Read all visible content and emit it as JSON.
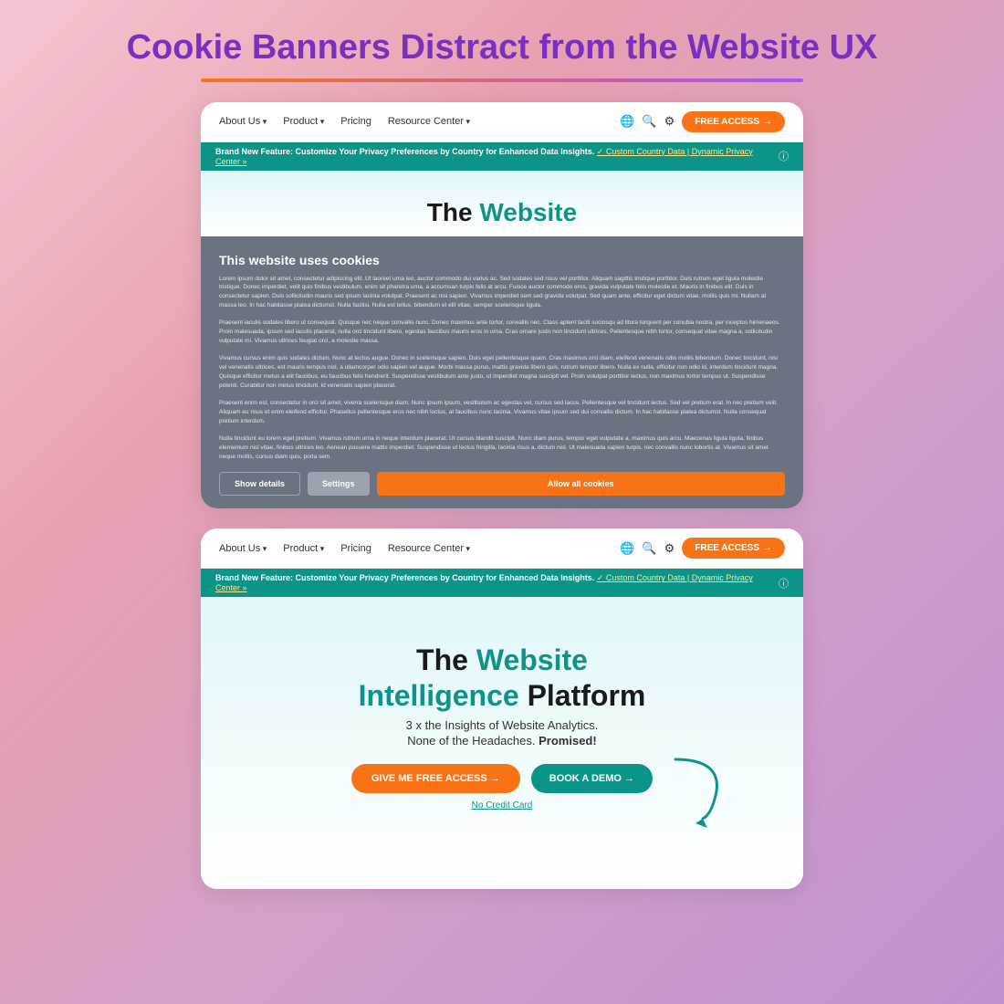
{
  "page": {
    "title_line1": "Cookie Banners Distract from the Website UX"
  },
  "navbar": {
    "about": "About Us",
    "product": "Product",
    "pricing": "Pricing",
    "resource": "Resource Center",
    "free_access": "FREE ACCESS",
    "arrow": "→"
  },
  "teal_banner": {
    "text": "Brand New Feature: Customize Your Privacy Preferences by Country for Enhanced Data Insights.",
    "link_text": "✓ Custom Country Data | Dynamic Privacy Center »",
    "close": "ⓘ"
  },
  "hero_top": {
    "title_plain": "The",
    "title_accent": "Website"
  },
  "cookie": {
    "title": "This website uses cookies",
    "body1": "Lorem ipsum dolor sit amet, consectetur adipiscing elit. Ut laoreet urna leo, auctor commodo dui varius ac. Sed sodales sed risus vel porttitor. Aliquam sagittis tristique porttitor. Duis rutrum eget ligula molestie tristique. Donec imperdiet, velit quis finibus vestibulum, enim sit pharetra urna, a accumsan turpis felis at arcu. Fuisce auctor commodo eros, gravida vulputate felis molestie et. Mauris in finibus elit. Duis in consectetur sapien. Duis sollicitudin mauris sed ipsum lacinia volutpat. Praesent ac nisi sapien. Vivamus imperdiet sem sed gravida volutpat. Sed quam ante, efficitur eget dictum vitae, mollis quis mi. Nullam at massa leo. In hac habitasse platea dictumst. Nulla facilisi. Nulla est tellus, bibendum et elit vitae, semper scelerisque ligula.",
    "body2": "Praesent iaculis sodales libero ut consequat. Quisque nec neque convallis nunc. Donec maximus ante tortor, convallis nec. Class aptent taciti sociosqu ad litora torquent per conubia nostra, per inceptos himenaeos. Proin malesuada, ipsum sed iaculis placerat, nulla orci tincidunt libero, egestas faucibus mauris eros in urna. Cras ornare justo non tincidunt ultrices. Pellentesque nibh tortor, consequat vitae magna a, sollicitudin vulputate mi. Vivamus ultrices feugiat orci, a molestie massa.",
    "body3": "Vivamus cursus enim quis sodales dictum. Nunc at lectus augue. Donec in scelerisque sapien. Duis eget pellentesque quam. Cras maximus orci diam, eleifend venenatis odio mollis bibendum. Donec tincidunt, nisi vel venenatis ultrices, est mauris tempus nisl, a ullamcorper odio sapien vel augue. Morbi massa purus, mattis gravida libero quis, rutrum tempor libero. Nulla ex nulla, efficitur non odio id, interdum tincidunt magna. Quisque efficitur metus a elit faucibus, eu faucibus felis hendrerit. Suspendisse vestibulum ante justo, ut imperdiet magna suscipit vel. Proin volutpat porttitor lectus, non maximus tortor tempus ut. Suspendisse potenti. Curabitur non metus tincidunt, id venenatis sapien placerat.",
    "body4": "Praesent enim est, consectetur in orci sit amet, viverra scelerisque diam. Nunc ipsum ipsum, vestibulum ac egestas vel, cursus sed lacus. Pellentesque vel tincidunt lectus. Sed vel pretium erat. In nec pretium velit. Aliquam eu risus et enim eleifend efficitur. Phasellus pellentesque eros nec nibh luctus, at faucibus nunc lacinia. Vivamus vitae ipsum sed dui convallis dictum. In hac habitasse platea dictumst. Nulla consequat pretium interdum.",
    "body5": "Nulla tincidunt eu lorem eget pretium. Vivamus rutrum urna in neque interdum placerat. Ut cursus blandit suscipit. Nunc diam purus, tempor eget vulputate a, maximus quis arcu. Maecenas ligula ligula, finibus elementum nisl vitae, finibus ultrices leo. Aenean posuere mattis imperdiet. Suspendisse ut lectus fringilla, lacinia risus a, dictum nisl. Ut malesuada sapien turpis, nec convallis nunc lobortis at. Vivamus sit amet neque mollis, cursus diam quis, porta sem.",
    "btn_show": "Show details",
    "btn_settings": "Settings",
    "btn_allow": "Allow all cookies"
  },
  "hero_bottom": {
    "title_plain": "The",
    "title_accent": "Website",
    "line2_accent": "Intelligence",
    "line2_plain": "Platform",
    "subtitle1": "3 x the Insights of Website Analytics.",
    "subtitle2": "None of the Headaches.",
    "subtitle2_bold": "Promised!",
    "cta_primary": "GIVE ME FREE ACCESS →",
    "cta_secondary": "BOOK A DEMO →",
    "no_credit": "No Credit Card"
  }
}
